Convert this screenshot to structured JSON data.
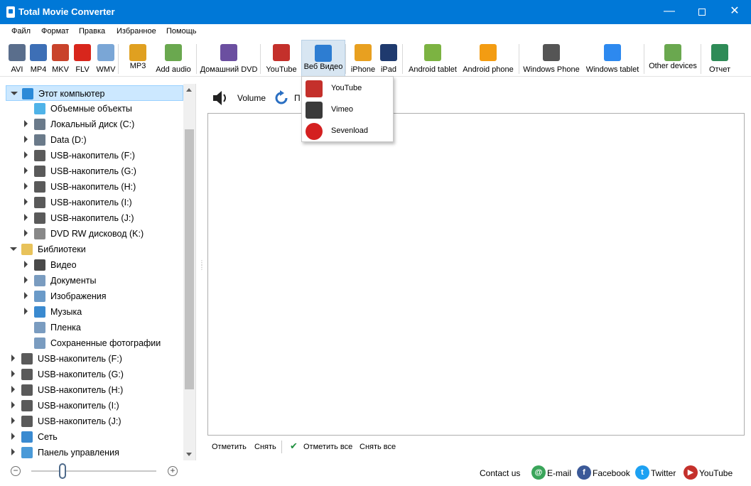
{
  "window": {
    "title": "Total Movie Converter",
    "minimize_glyph": "—",
    "close_glyph": "✕"
  },
  "menu": [
    "Файл",
    "Формат",
    "Правка",
    "Избранное",
    "Помощь"
  ],
  "toolbar": [
    {
      "id": "avi",
      "label": "AVI",
      "icon": "avi-icon",
      "color": "#5a6e8c"
    },
    {
      "id": "mp4",
      "label": "MP4",
      "icon": "eye-icon",
      "color": "#3d6fb6"
    },
    {
      "id": "mkv",
      "label": "MKV",
      "icon": "matryoshka-icon",
      "color": "#c9432b"
    },
    {
      "id": "flv",
      "label": "FLV",
      "icon": "flash-icon",
      "color": "#d8261c"
    },
    {
      "id": "wmv",
      "label": "WMV",
      "icon": "wmv-icon",
      "color": "#7aa6d6"
    },
    {
      "id": "mp3",
      "label": "MP3",
      "icon": "music-note-icon",
      "color": "#e0a020"
    },
    {
      "id": "add_audio",
      "label": "Add audio",
      "icon": "speaker-icon",
      "color": "#6aa84f"
    },
    {
      "id": "dvd",
      "label": "Домашний DVD",
      "icon": "dvd-disc-icon",
      "color": "#6b4fa0"
    },
    {
      "id": "youtube",
      "label": "YouTube",
      "icon": "youtube-icon",
      "color": "#c4302b"
    },
    {
      "id": "web_video",
      "label": "Веб Видео",
      "icon": "globe-icon",
      "color": "#2d7dd2"
    },
    {
      "id": "iphone",
      "label": "iPhone",
      "icon": "iphone-icon",
      "color": "#e8a020"
    },
    {
      "id": "ipad",
      "label": "iPad",
      "icon": "ipad-icon",
      "color": "#1f3a6e"
    },
    {
      "id": "android_tablet",
      "label": "Android tablet",
      "icon": "android-icon",
      "color": "#7cb342"
    },
    {
      "id": "android_phone",
      "label": "Android phone",
      "icon": "android-phone-icon",
      "color": "#f39c12"
    },
    {
      "id": "windows_phone",
      "label": "Windows Phone",
      "icon": "windows-phone-icon",
      "color": "#555555"
    },
    {
      "id": "windows_tablet",
      "label": "Windows tablet",
      "icon": "windows-logo-icon",
      "color": "#2d89ef"
    },
    {
      "id": "other_devices",
      "label": "Other devices",
      "icon": "tablet-icon",
      "color": "#6aa84f"
    },
    {
      "id": "report",
      "label": "Отчет",
      "icon": "report-icon",
      "color": "#2e8b57"
    }
  ],
  "web_video_menu": [
    {
      "label": "YouTube",
      "icon": "youtube-icon",
      "color": "#c4302b"
    },
    {
      "label": "Vimeo",
      "icon": "vimeo-icon",
      "color": "#3a3a3a"
    },
    {
      "label": "Sevenload",
      "icon": "sevenload-icon",
      "color": "#d42020"
    }
  ],
  "tree": [
    {
      "label": "Этот компьютер",
      "indent": 0,
      "arrow": "down",
      "icon": "computer-icon",
      "color": "#2c8ad8",
      "selected": true
    },
    {
      "label": "Объемные объекты",
      "indent": 1,
      "arrow": "",
      "icon": "cube-icon",
      "color": "#4fb3e8"
    },
    {
      "label": "Локальный диск (C:)",
      "indent": 1,
      "arrow": "right",
      "icon": "drive-icon",
      "color": "#6a7a8a"
    },
    {
      "label": "Data (D:)",
      "indent": 1,
      "arrow": "right",
      "icon": "drive-icon",
      "color": "#6a7a8a"
    },
    {
      "label": "USB-накопитель (F:)",
      "indent": 1,
      "arrow": "right",
      "icon": "usb-drive-icon",
      "color": "#5a5a5a"
    },
    {
      "label": "USB-накопитель (G:)",
      "indent": 1,
      "arrow": "right",
      "icon": "usb-drive-icon",
      "color": "#5a5a5a"
    },
    {
      "label": "USB-накопитель (H:)",
      "indent": 1,
      "arrow": "right",
      "icon": "usb-drive-icon",
      "color": "#5a5a5a"
    },
    {
      "label": "USB-накопитель (I:)",
      "indent": 1,
      "arrow": "right",
      "icon": "usb-drive-icon",
      "color": "#5a5a5a"
    },
    {
      "label": "USB-накопитель (J:)",
      "indent": 1,
      "arrow": "right",
      "icon": "usb-drive-icon",
      "color": "#5a5a5a"
    },
    {
      "label": "DVD RW дисковод (K:)",
      "indent": 1,
      "arrow": "right",
      "icon": "dvd-drive-icon",
      "color": "#888888"
    },
    {
      "label": "Библиотеки",
      "indent": 0,
      "arrow": "down",
      "icon": "library-folder-icon",
      "color": "#e8c25a"
    },
    {
      "label": "Видео",
      "indent": 1,
      "arrow": "right",
      "icon": "film-icon",
      "color": "#4a4a4a"
    },
    {
      "label": "Документы",
      "indent": 1,
      "arrow": "right",
      "icon": "document-icon",
      "color": "#7a9cc0"
    },
    {
      "label": "Изображения",
      "indent": 1,
      "arrow": "right",
      "icon": "image-icon",
      "color": "#6a9ac8"
    },
    {
      "label": "Музыка",
      "indent": 1,
      "arrow": "right",
      "icon": "music-icon",
      "color": "#3a8ad0"
    },
    {
      "label": "Пленка",
      "indent": 1,
      "arrow": "",
      "icon": "film-roll-icon",
      "color": "#7a9cc0"
    },
    {
      "label": "Сохраненные фотографии",
      "indent": 1,
      "arrow": "",
      "icon": "photo-icon",
      "color": "#7a9cc0"
    },
    {
      "label": "USB-накопитель (F:)",
      "indent": 0,
      "arrow": "right",
      "icon": "usb-drive-icon",
      "color": "#5a5a5a"
    },
    {
      "label": "USB-накопитель (G:)",
      "indent": 0,
      "arrow": "right",
      "icon": "usb-drive-icon",
      "color": "#5a5a5a"
    },
    {
      "label": "USB-накопитель (H:)",
      "indent": 0,
      "arrow": "right",
      "icon": "usb-drive-icon",
      "color": "#5a5a5a"
    },
    {
      "label": "USB-накопитель (I:)",
      "indent": 0,
      "arrow": "right",
      "icon": "usb-drive-icon",
      "color": "#5a5a5a"
    },
    {
      "label": "USB-накопитель (J:)",
      "indent": 0,
      "arrow": "right",
      "icon": "usb-drive-icon",
      "color": "#5a5a5a"
    },
    {
      "label": "Сеть",
      "indent": 0,
      "arrow": "right",
      "icon": "network-icon",
      "color": "#3a8ad0"
    },
    {
      "label": "Панель управления",
      "indent": 0,
      "arrow": "right",
      "icon": "control-panel-icon",
      "color": "#4a9ad8"
    }
  ],
  "right_toolbar": {
    "volume_label": "Volume",
    "refresh_label": "П"
  },
  "select_bar": {
    "mark": "Отметить",
    "unmark": "Снять",
    "mark_all": "Отметить все",
    "unmark_all": "Снять все"
  },
  "status": {
    "contact_us": "Contact us",
    "links": [
      {
        "label": "E-mail",
        "icon": "email-icon",
        "glyph": "@",
        "color": "#3aa55a"
      },
      {
        "label": "Facebook",
        "icon": "facebook-icon",
        "glyph": "f",
        "color": "#3b5998"
      },
      {
        "label": "Twitter",
        "icon": "twitter-icon",
        "glyph": "t",
        "color": "#1da1f2"
      },
      {
        "label": "YouTube",
        "icon": "youtube-icon",
        "glyph": "▶",
        "color": "#c4302b"
      }
    ],
    "zoom_fraction": 0.25
  },
  "accent_color": "#0078d7"
}
